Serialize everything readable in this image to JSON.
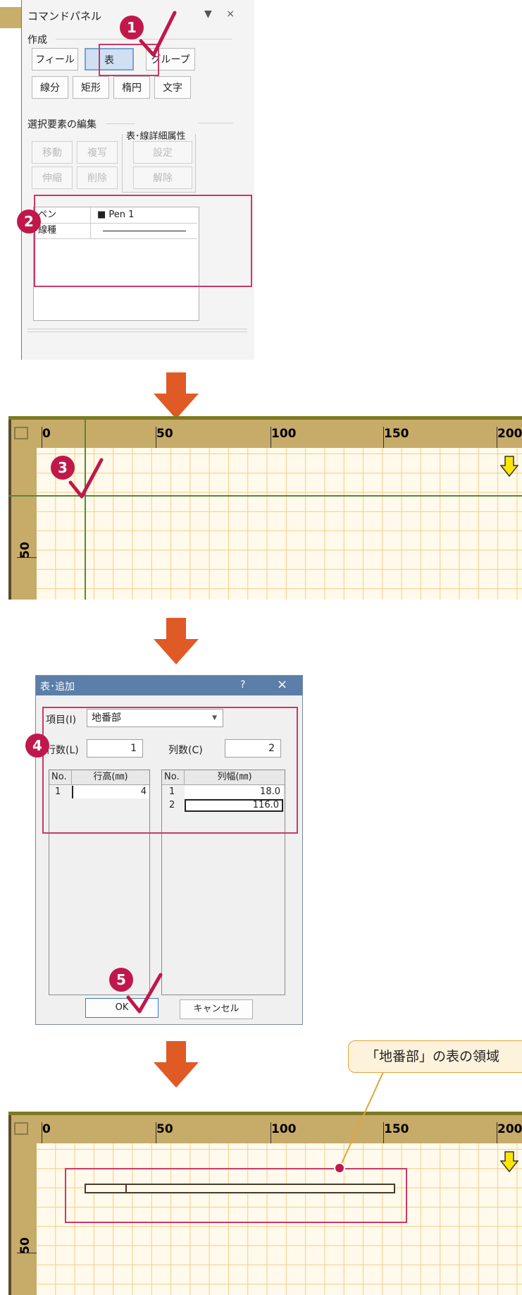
{
  "command_panel": {
    "title": "コマンドパネル",
    "controls": "▼ ×",
    "create_group": {
      "label": "作成",
      "buttons": [
        "フィールド",
        "表",
        "グループ",
        "線分",
        "矩形",
        "楕円",
        "文字"
      ],
      "selected": "表"
    },
    "edit_group": {
      "label": "選択要素の編集",
      "buttons": [
        "移動",
        "複写",
        "伸縮",
        "削除"
      ]
    },
    "attr_group": {
      "label": "表･線詳細属性",
      "buttons": [
        "設定",
        "解除"
      ]
    },
    "properties": [
      {
        "name": "ペン",
        "value": "■ Pen 1"
      },
      {
        "name": "線種",
        "value": ""
      }
    ]
  },
  "steps": {
    "s1": "1",
    "s2": "2",
    "s3": "3",
    "s4": "4",
    "s5": "5"
  },
  "ruler": {
    "labels": [
      "0",
      "50",
      "100",
      "150",
      "200"
    ],
    "vlabel": "50"
  },
  "dialog": {
    "title": "表･追加",
    "help": "?",
    "close": "×",
    "item_label": "項目(I)",
    "item_value": "地番部",
    "rows_label": "行数(L)",
    "rows_value": "1",
    "cols_label": "列数(C)",
    "cols_value": "2",
    "row_table": {
      "headers": [
        "No.",
        "行高(㎜)"
      ],
      "rows": [
        {
          "no": "1",
          "val": "4"
        }
      ]
    },
    "col_table": {
      "headers": [
        "No.",
        "列幅(㎜)"
      ],
      "rows": [
        {
          "no": "1",
          "val": "18.0"
        },
        {
          "no": "2",
          "val": "116.0"
        }
      ]
    },
    "ok": "OK",
    "cancel": "キャンセル"
  },
  "callout": {
    "text": "「地番部」の表の領域"
  },
  "colors": {
    "accent": "#c0184a",
    "arrow": "#e05a26",
    "grid": "#f6cc87",
    "ruler": "#c7ab69",
    "callout_border": "#e2a43c"
  }
}
